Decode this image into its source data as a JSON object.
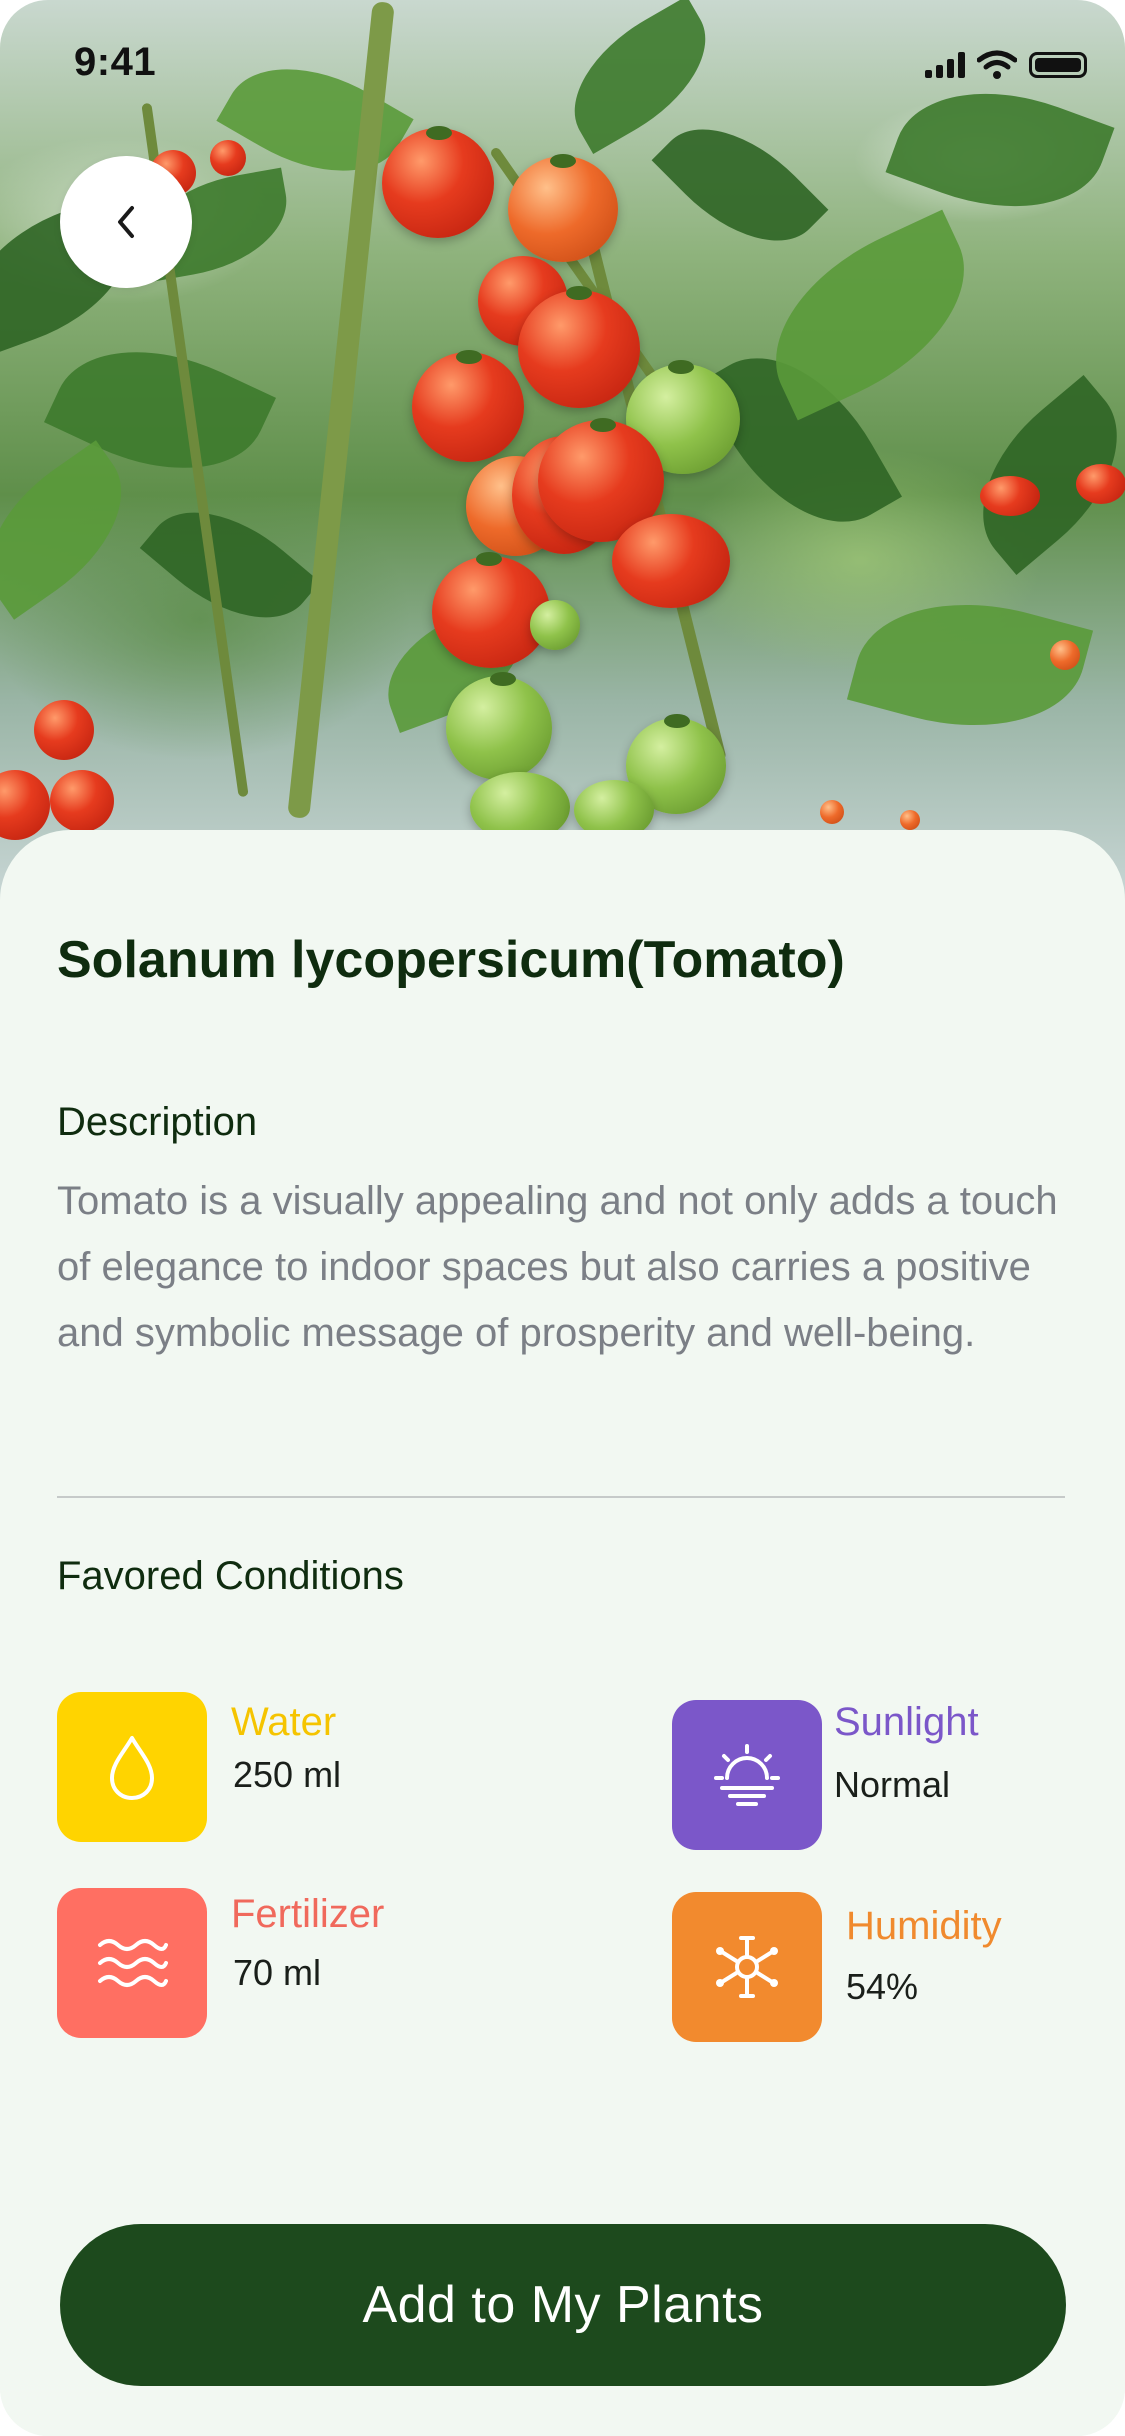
{
  "status_bar": {
    "time": "9:41"
  },
  "plant": {
    "title": "Solanum lycopersicum(Tomato)",
    "description_heading": "Description",
    "description": "Tomato is a visually appealing and not only adds a touch of elegance to indoor spaces but also carries a positive and symbolic message of prosperity and well-being."
  },
  "conditions": {
    "heading": "Favored Conditions",
    "items": [
      {
        "label": "Water",
        "value": "250 ml",
        "icon": "water-drop-icon",
        "color": "#FFD400",
        "label_color": "#F5C400"
      },
      {
        "label": "Sunlight",
        "value": "Normal",
        "icon": "sunrise-icon",
        "color": "#7B57C9",
        "label_color": "#7B57C9"
      },
      {
        "label": "Fertilizer",
        "value": "70 ml",
        "icon": "waves-icon",
        "color": "#FF6F62",
        "label_color": "#F0695C"
      },
      {
        "label": "Humidity",
        "value": "54%",
        "icon": "snowflake-icon",
        "color": "#F28A2E",
        "label_color": "#F08A2E"
      }
    ]
  },
  "actions": {
    "add_label": "Add to My Plants"
  },
  "colors": {
    "primary": "#1D4A1D",
    "background": "#F2F8F2",
    "title": "#0F2C0F",
    "body_text": "#7B7F86"
  }
}
